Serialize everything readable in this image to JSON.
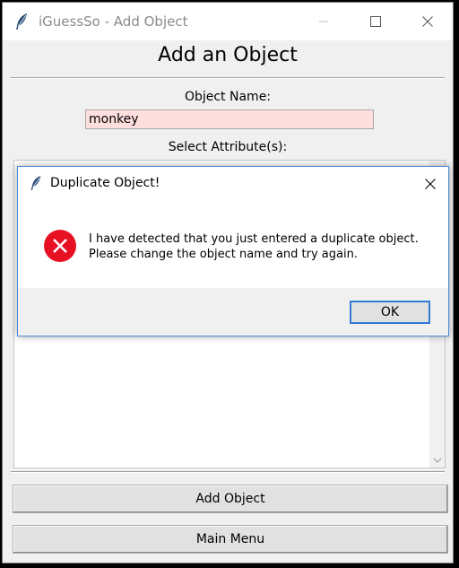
{
  "window": {
    "title": "iGuessSo - Add Object"
  },
  "main": {
    "heading": "Add an Object",
    "object_name_label": "Object Name:",
    "object_name_value": "monkey",
    "select_attributes_label": "Select Attribute(s):",
    "add_object_label": "Add Object",
    "main_menu_label": "Main Menu"
  },
  "dialog": {
    "title": "Duplicate Object!",
    "message_line1": "I have detected that you just entered a duplicate object.",
    "message_line2": "Please change the object name and try again.",
    "ok_label": "OK"
  },
  "colors": {
    "input_background": "#ffdede",
    "dialog_border": "#4a8bd6",
    "error_red": "#e81123",
    "ok_border": "#2f7bd6"
  },
  "icons": {
    "app": "feather-icon",
    "minimize": "minimize-icon",
    "maximize": "maximize-icon",
    "close": "close-icon",
    "error": "error-icon",
    "scroll_down": "chevron-down-icon"
  }
}
